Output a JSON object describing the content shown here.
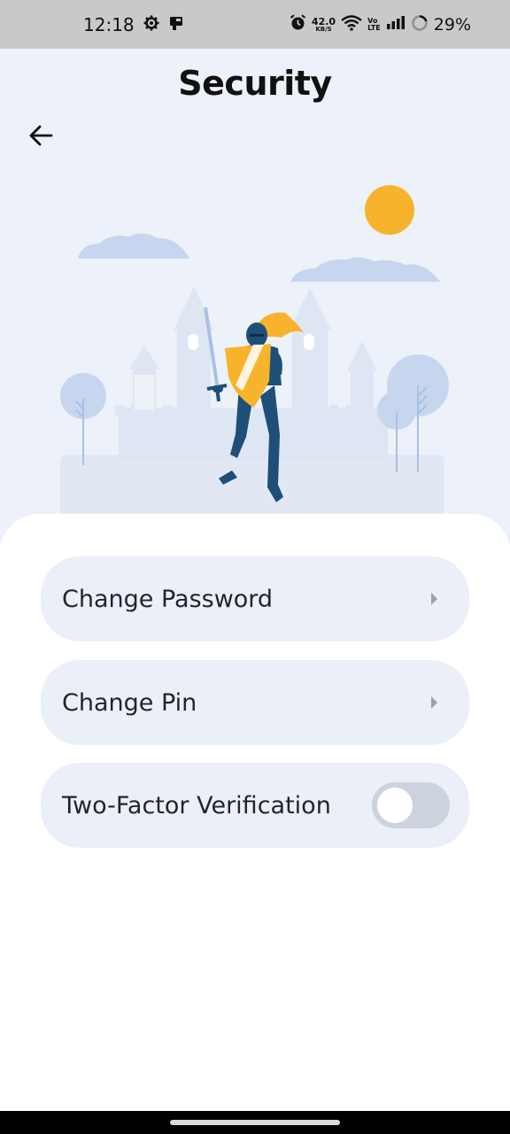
{
  "status_bar": {
    "time": "12:18",
    "net_speed_value": "42.0",
    "net_speed_unit": "KB/S",
    "volte_line1": "Vo",
    "volte_line2": "LTE",
    "battery_percent": "29%",
    "icons": [
      "settings-gear-icon",
      "notification-app-icon",
      "alarm-icon",
      "wifi-icon",
      "signal-icon",
      "battery-ring-icon"
    ]
  },
  "header": {
    "title": "Security",
    "back_icon": "arrow-left-icon"
  },
  "illustration": {
    "subject": "knight-with-shield-and-sword",
    "colors": {
      "sun": "#f7b32b",
      "shield": "#f7b32b",
      "armor": "#1e4f78",
      "clouds": "#c7d6ef",
      "castle": "#dfe6f3"
    }
  },
  "menu": {
    "items": [
      {
        "label": "Change Password",
        "trailing": "chevron-right-icon"
      },
      {
        "label": "Change Pin",
        "trailing": "chevron-right-icon"
      },
      {
        "label": "Two-Factor Verification",
        "trailing": "toggle",
        "toggle_on": false
      }
    ]
  },
  "colors": {
    "background_top": "#edf1f9",
    "card": "#eaeff8",
    "toggle_off": "#cdd3dc",
    "text": "#1f2430"
  }
}
